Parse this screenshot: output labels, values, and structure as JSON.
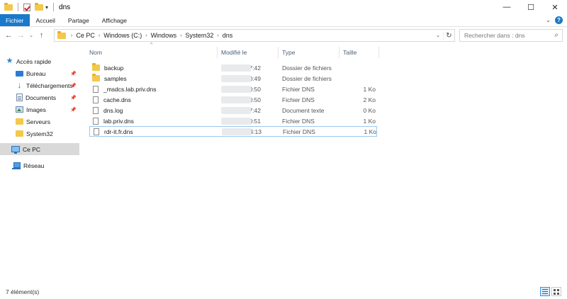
{
  "window": {
    "title": "dns",
    "minimize_glyph": "—",
    "maximize_glyph": "☐",
    "close_glyph": "✕"
  },
  "ribbon": {
    "tabs": [
      {
        "label": "Fichier",
        "active": true
      },
      {
        "label": "Accueil",
        "active": false
      },
      {
        "label": "Partage",
        "active": false
      },
      {
        "label": "Affichage",
        "active": false
      }
    ],
    "help_glyph": "?"
  },
  "address": {
    "crumbs": [
      "Ce PC",
      "Windows (C:)",
      "Windows",
      "System32",
      "dns"
    ]
  },
  "search": {
    "placeholder": "Rechercher dans : dns"
  },
  "sidebar": {
    "items": [
      {
        "label": "Accès rapide",
        "icon": "star-icon"
      },
      {
        "label": "Bureau",
        "icon": "desktop-icon",
        "pinned": true
      },
      {
        "label": "Téléchargements",
        "icon": "download-icon",
        "pinned": true
      },
      {
        "label": "Documents",
        "icon": "documents-icon",
        "pinned": true
      },
      {
        "label": "Images",
        "icon": "pictures-icon",
        "pinned": true
      },
      {
        "label": "Serveurs",
        "icon": "folder-icon"
      },
      {
        "label": "System32",
        "icon": "folder-icon"
      },
      {
        "label": "Ce PC",
        "icon": "computer-icon",
        "selected": true
      },
      {
        "label": "Réseau",
        "icon": "network-icon"
      }
    ]
  },
  "columns": {
    "name": "Nom",
    "modified": "Modifié le",
    "type": "Type",
    "size": "Taille"
  },
  "files": [
    {
      "name": "backup",
      "time": "17:42",
      "type": "Dossier de fichiers",
      "size": "",
      "kind": "folder"
    },
    {
      "name": "samples",
      "time": "10:49",
      "type": "Dossier de fichiers",
      "size": "",
      "kind": "folder"
    },
    {
      "name": "_msdcs.lab.priv.dns",
      "time": "10:50",
      "type": "Fichier DNS",
      "size": "1 Ko",
      "kind": "file"
    },
    {
      "name": "cache.dns",
      "time": "10:50",
      "type": "Fichier DNS",
      "size": "2 Ko",
      "kind": "file"
    },
    {
      "name": "dns.log",
      "time": "17:42",
      "type": "Document texte",
      "size": "0 Ko",
      "kind": "file"
    },
    {
      "name": "lab.priv.dns",
      "time": "10:51",
      "type": "Fichier DNS",
      "size": "1 Ko",
      "kind": "file"
    },
    {
      "name": "rdr-it.fr.dns",
      "time": "14:13",
      "type": "Fichier DNS",
      "size": "1 Ko",
      "kind": "file",
      "focused": true
    }
  ],
  "status": {
    "count": "7 élément(s)"
  }
}
